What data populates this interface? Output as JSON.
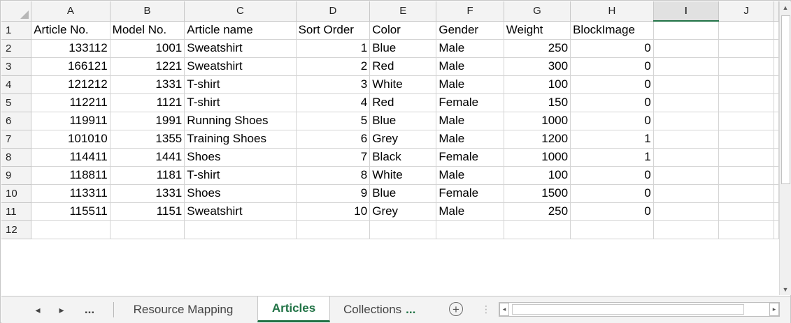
{
  "columns": [
    "A",
    "B",
    "C",
    "D",
    "E",
    "F",
    "G",
    "H",
    "I",
    "J"
  ],
  "selected_column": "I",
  "row_numbers": [
    "1",
    "2",
    "3",
    "4",
    "5",
    "6",
    "7",
    "8",
    "9",
    "10",
    "11",
    "12"
  ],
  "headers": [
    "Article No.",
    "Model No.",
    "Article name",
    "Sort Order",
    "Color",
    "Gender",
    "Weight",
    "BlockImage",
    "",
    ""
  ],
  "rows": [
    [
      "133112",
      "1001",
      "Sweatshirt",
      "1",
      "Blue",
      "Male",
      "250",
      "0",
      "",
      ""
    ],
    [
      "166121",
      "1221",
      "Sweatshirt",
      "2",
      "Red",
      "Male",
      "300",
      "0",
      "",
      ""
    ],
    [
      "121212",
      "1331",
      "T-shirt",
      "3",
      "White",
      "Male",
      "100",
      "0",
      "",
      ""
    ],
    [
      "112211",
      "1121",
      "T-shirt",
      "4",
      "Red",
      "Female",
      "150",
      "0",
      "",
      ""
    ],
    [
      "119911",
      "1991",
      "Running Shoes",
      "5",
      "Blue",
      "Male",
      "1000",
      "0",
      "",
      ""
    ],
    [
      "101010",
      "1355",
      "Training Shoes",
      "6",
      "Grey",
      "Male",
      "1200",
      "1",
      "",
      ""
    ],
    [
      "114411",
      "1441",
      "Shoes",
      "7",
      "Black",
      "Female",
      "1000",
      "1",
      "",
      ""
    ],
    [
      "118811",
      "1181",
      "T-shirt",
      "8",
      "White",
      "Male",
      "100",
      "0",
      "",
      ""
    ],
    [
      "113311",
      "1331",
      "Shoes",
      "9",
      "Blue",
      "Female",
      "1500",
      "0",
      "",
      ""
    ],
    [
      "115511",
      "1151",
      "Sweatshirt",
      "10",
      "Grey",
      "Male",
      "250",
      "0",
      "",
      ""
    ],
    [
      "",
      "",
      "",
      "",
      "",
      "",
      "",
      "",
      "",
      ""
    ]
  ],
  "tabs": {
    "prev_icon": "◂",
    "next_icon": "▸",
    "more_left": "...",
    "items": [
      {
        "label": "Resource Mapping",
        "active": false
      },
      {
        "label": "Articles",
        "active": true
      },
      {
        "label": "Collections",
        "active": false
      }
    ],
    "more_right": "...",
    "add_icon": "+",
    "split_icon": "⋮"
  },
  "scroll": {
    "up_icon": "▲",
    "down_icon": "▼",
    "left_icon": "◂",
    "right_icon": "▸"
  },
  "colors": {
    "accent": "#217346",
    "header_bg": "#f3f3f3",
    "gridline": "#d4d4d4"
  }
}
